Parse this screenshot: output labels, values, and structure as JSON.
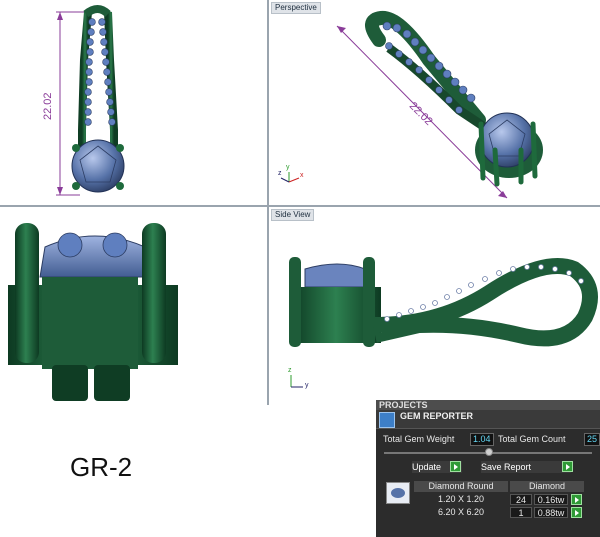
{
  "viewports": {
    "top_left": {
      "dimension": "22.02"
    },
    "top_right": {
      "title": "Perspective",
      "dimension": "22.02",
      "axes": {
        "x": "x",
        "y": "y",
        "z": "z"
      }
    },
    "bottom_left": {},
    "bottom_right": {
      "title": "Side View",
      "axes": {
        "z": "z",
        "y": "y"
      }
    }
  },
  "model_label": "GR-2",
  "panel": {
    "header": "PROJECTS",
    "title": "GEM REPORTER",
    "total_gem_weight_label": "Total Gem Weight",
    "total_gem_weight_value": "1.04",
    "total_gem_count_label": "Total Gem Count",
    "total_gem_count_value": "25",
    "update_label": "Update",
    "save_report_label": "Save Report",
    "table": {
      "headers": [
        "Diamond Round",
        "Diamond"
      ],
      "rows": [
        {
          "size": "1.20 X 1.20",
          "count": "24",
          "weight": "0.16tw"
        },
        {
          "size": "6.20 X 6.20",
          "count": "1",
          "weight": "0.88tw"
        }
      ]
    }
  },
  "colors": {
    "metal": "#1e5c39",
    "gem": "#5672a8",
    "dimension": "#8a3c99",
    "panel_bg": "#2c2c2c",
    "value_text": "#63d6f2",
    "go_button": "#2f9a36"
  }
}
